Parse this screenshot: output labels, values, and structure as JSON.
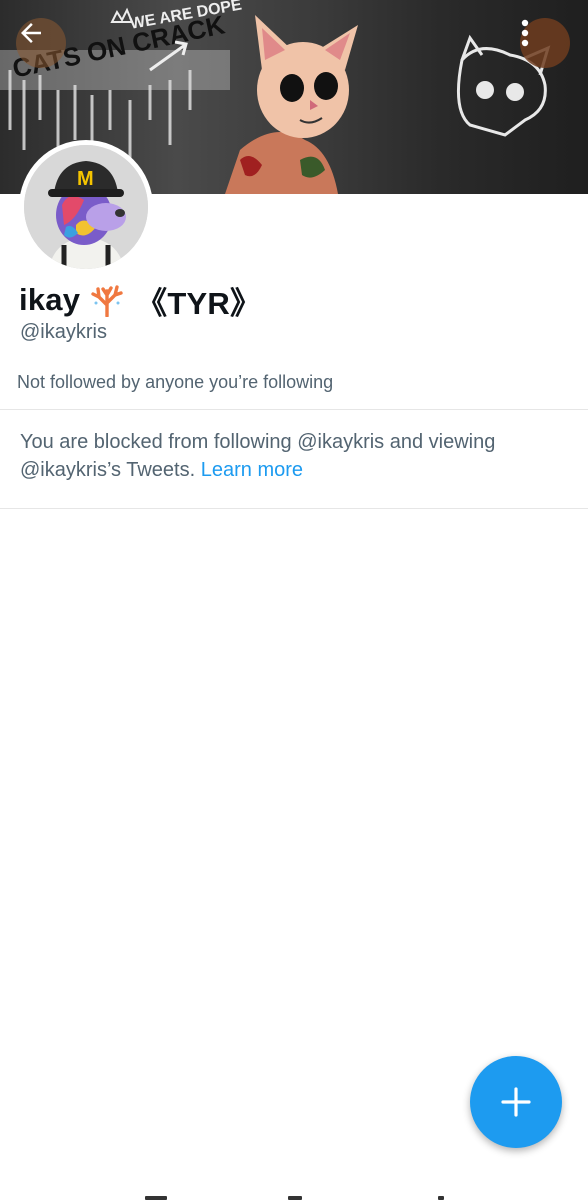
{
  "profile": {
    "display_name": "ikay",
    "name_suffix": "《TYR》",
    "handle": "@ikaykris",
    "followers_note": "Not followed by anyone you’re following"
  },
  "blocked_notice": {
    "text": "You are blocked from following @ikaykris and viewing @ikaykris’s Tweets.",
    "link": "Learn more"
  },
  "banner": {
    "graffiti_text": "CATS ON CRACK",
    "graffiti_text_2": "WE ARE DOPE"
  },
  "avatar": {
    "hat_logo": "M"
  },
  "icons": {
    "back": "arrow-left-icon",
    "more": "more-vertical-icon",
    "coral": "coral-emoji-icon",
    "compose": "plus-icon"
  },
  "colors": {
    "accent": "#1d9bf0",
    "secondary_text": "#536471",
    "primary_text": "#0f1419"
  }
}
